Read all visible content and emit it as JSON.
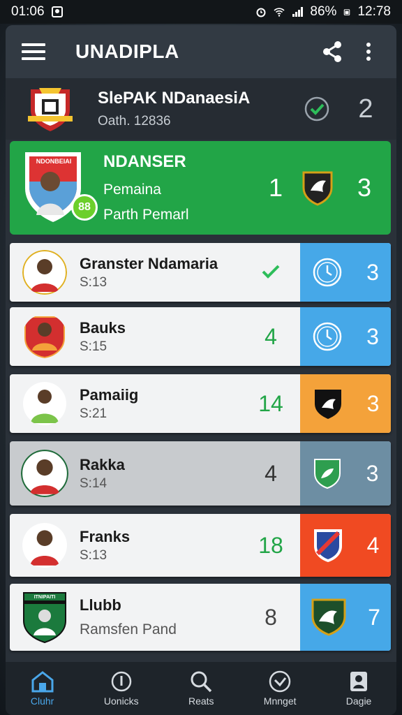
{
  "status_bar": {
    "time": "01:06",
    "battery": "86%",
    "clock": "12:78"
  },
  "app_bar": {
    "title": "UNADIPLA"
  },
  "header": {
    "name": "SlePAK NDanaesiA",
    "subtitle": "Oath. 12836",
    "score": "2"
  },
  "highlight": {
    "name": "NDANSER",
    "line2": "Pemaina",
    "line3": "Parth Pemarl",
    "number": "1",
    "score": "3",
    "crest_text": "NDONBEIAI",
    "avatar_badge": "88"
  },
  "rows": [
    {
      "name": "Granster Ndamaria",
      "sub": "S:13",
      "mid": "",
      "score": "3"
    },
    {
      "name": "Bauks",
      "sub": "S:15",
      "mid": "4",
      "score": "3"
    },
    {
      "name": "Pamaiig",
      "sub": "S:21",
      "mid": "14",
      "score": "3"
    },
    {
      "name": "Rakka",
      "sub": "S:14",
      "mid": "4",
      "score": "3"
    },
    {
      "name": "Franks",
      "sub": "S:13",
      "mid": "18",
      "score": "4"
    },
    {
      "name": "Llubb",
      "sub": "Ramsfen Pand",
      "mid": "8",
      "score": "7",
      "crest_text": "ITNIPAITI"
    }
  ],
  "bottom_nav": [
    {
      "label": "Cluhr"
    },
    {
      "label": "Uonicks"
    },
    {
      "label": "Reats"
    },
    {
      "label": "Mnnget"
    },
    {
      "label": "Dagie"
    }
  ],
  "colors": {
    "green": "#22a547",
    "blue": "#46a8e8",
    "orange": "#f4a23a",
    "slate": "#6d8ea3",
    "red": "#f04a22"
  }
}
